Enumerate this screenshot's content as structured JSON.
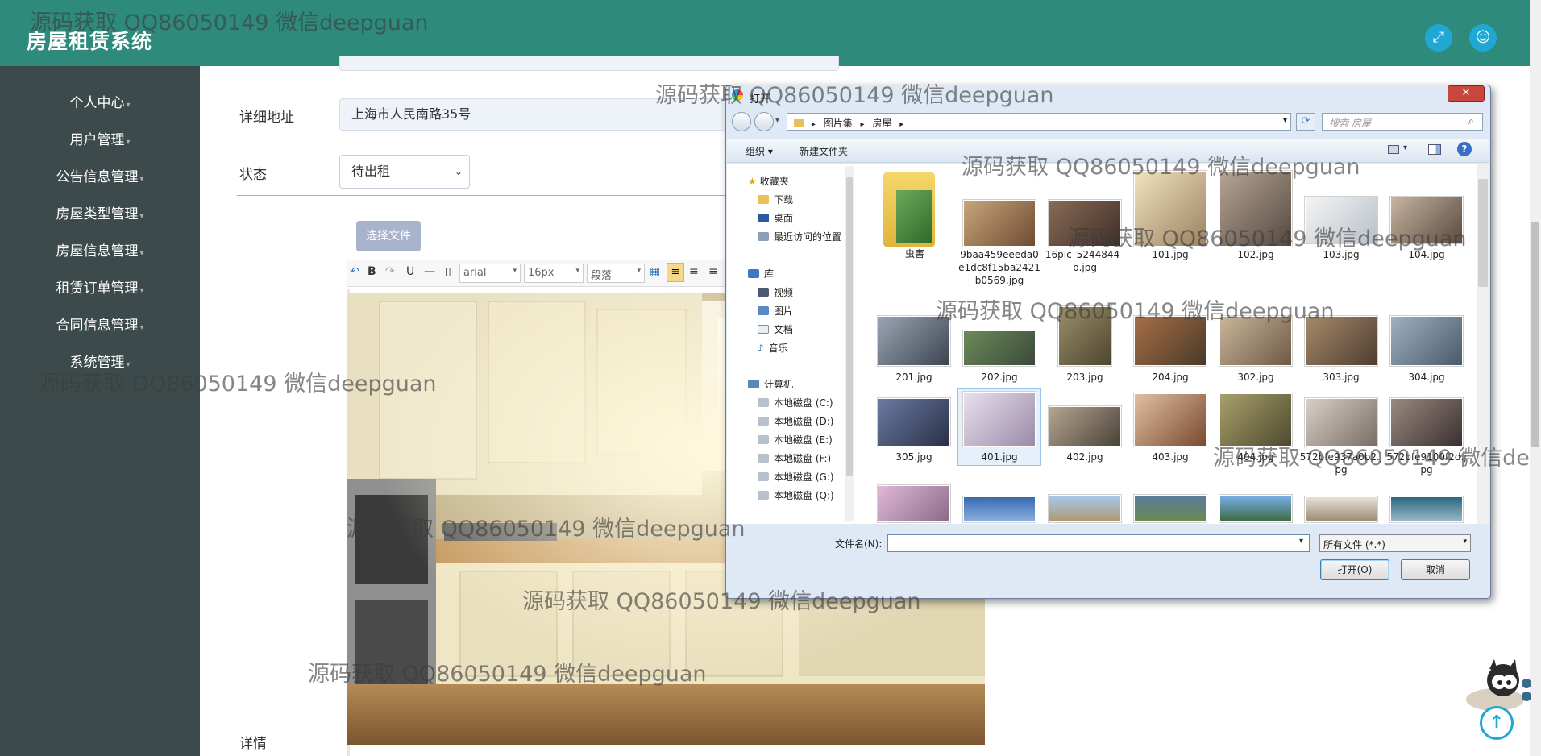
{
  "app": {
    "title": "房屋租赁系统"
  },
  "sidebar": {
    "items": [
      {
        "label": "个人中心"
      },
      {
        "label": "用户管理"
      },
      {
        "label": "公告信息管理"
      },
      {
        "label": "房屋类型管理"
      },
      {
        "label": "房屋信息管理"
      },
      {
        "label": "租赁订单管理"
      },
      {
        "label": "合同信息管理"
      },
      {
        "label": "系统管理"
      }
    ]
  },
  "form": {
    "address_label": "详细地址",
    "address_value": "上海市人民南路35号",
    "status_label": "状态",
    "status_value": "待出租",
    "upload_button": "选择文件",
    "detail_label": "详情",
    "toolbar": {
      "bold": "B",
      "underline": "U",
      "font": "arial",
      "size": "16px",
      "paragraph": "段落"
    }
  },
  "dialog": {
    "title": "打开",
    "close": "✕",
    "path": [
      "图片集",
      "房屋"
    ],
    "search_placeholder": "搜索 房屋",
    "organize": "组织 ▾",
    "new_folder": "新建文件夹",
    "nav": {
      "favorites": "收藏夹",
      "downloads": "下载",
      "desktop": "桌面",
      "recent": "最近访问的位置",
      "libraries": "库",
      "videos": "视频",
      "pictures": "图片",
      "documents": "文档",
      "music": "音乐",
      "computer": "计算机",
      "drives": [
        "本地磁盘 (C:)",
        "本地磁盘 (D:)",
        "本地磁盘 (E:)",
        "本地磁盘 (F:)",
        "本地磁盘 (G:)",
        "本地磁盘 (Q:)"
      ]
    },
    "files": [
      {
        "name": "虫害"
      },
      {
        "name": "9baa459eeeda0e1dc8f15ba2421b0569.jpg"
      },
      {
        "name": "16pic_5244844_b.jpg"
      },
      {
        "name": "101.jpg"
      },
      {
        "name": "102.jpg"
      },
      {
        "name": "103.jpg"
      },
      {
        "name": "104.jpg"
      },
      {
        "name": "201.jpg"
      },
      {
        "name": "202.jpg"
      },
      {
        "name": "203.jpg"
      },
      {
        "name": "204.jpg"
      },
      {
        "name": "302.jpg"
      },
      {
        "name": "303.jpg"
      },
      {
        "name": "304.jpg"
      },
      {
        "name": "305.jpg"
      },
      {
        "name": "401.jpg"
      },
      {
        "name": "402.jpg"
      },
      {
        "name": "403.jpg"
      },
      {
        "name": "404.jpg"
      },
      {
        "name": "572bfe937a0b2.jpg"
      },
      {
        "name": "572bfe9100f2d.jpg"
      }
    ],
    "filename_label": "文件名(N):",
    "filetype": "所有文件 (*.*)",
    "open_button": "打开(O)",
    "cancel_button": "取消"
  },
  "watermark": "源码获取 QQ86050149 微信deepguan",
  "colors": {
    "header": "#2e8b7c",
    "sidebar": "#3d4a4c",
    "accent": "#1fa8d4"
  }
}
